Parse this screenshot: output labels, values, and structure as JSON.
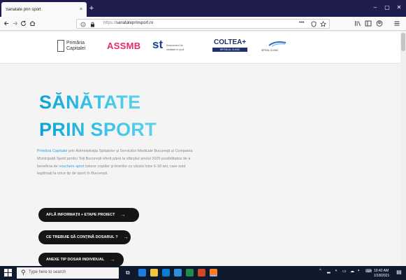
{
  "browser": {
    "tab_title": "Sănătate prin sport",
    "tab_close": "×",
    "new_tab": "+",
    "window_controls": [
      "–",
      "▢",
      "✕"
    ],
    "url_scheme": "https://",
    "url_host": "sanatateprinsport.ro",
    "nav_icons": [
      "arrow-left-icon",
      "arrow-right-icon",
      "reload-icon",
      "home-icon"
    ],
    "right_icons": [
      "page-actions-icon",
      "shield-icon",
      "star-icon",
      "library-icon",
      "sidebar-icon",
      "account-icon",
      "menu-icon"
    ]
  },
  "logos": {
    "primaria": [
      "Primăria",
      "Capitalei"
    ],
    "assmb": "ASSMB",
    "st_mark": "st",
    "st_sub": [
      "Simpozionul de",
      "sănătate în şcoli"
    ],
    "coltea_name": "COLTEA+",
    "coltea_band": "SPITALUL CLINIC",
    "hospital_text": "SPITAL CLINIC"
  },
  "hero": {
    "title_line_1": "SĂNĂTATE",
    "title_line_2": "PRIN SPORT",
    "description_parts": [
      {
        "text": "Primăria Capitalei",
        "hl": true
      },
      {
        "text": " prin Administrația Spitalelor și Serviciilor Medicale București și Compania Municipală Sport pentru Toți București oferă până la sfârșitul anului 2025 posibilitatea de a beneficia de ",
        "hl": false
      },
      {
        "text": "vouchere sport",
        "hl": true
      },
      {
        "text": " tuturor copiilor și tinerilor cu vârsta între 6-18 ani, care sunt legitimați la orice tip de sport în București.",
        "hl": false
      }
    ],
    "buttons": [
      {
        "label": "AFLĂ INFORMAȚII + ETAPE PROIECT",
        "arrow": "→"
      },
      {
        "label": "CE TREBUIE SĂ CONȚINĂ DOSARUL ?",
        "arrow": "→"
      },
      {
        "label": "ANEXE TIP DOSAR INDIVIDUAL",
        "arrow": "→"
      }
    ]
  },
  "taskbar": {
    "search_placeholder": "Type here to search",
    "time": "10:42 AM",
    "date": "1/18/2021",
    "colors": {
      "edge": "#1f7ae0",
      "explorer": "#f2c33c",
      "store": "#0b7bd3",
      "mail": "#2f8fdf",
      "firefox": "#ff7b24",
      "excel": "#1f8a4b",
      "word": "#2b5ea8",
      "ppt": "#d24726"
    }
  }
}
